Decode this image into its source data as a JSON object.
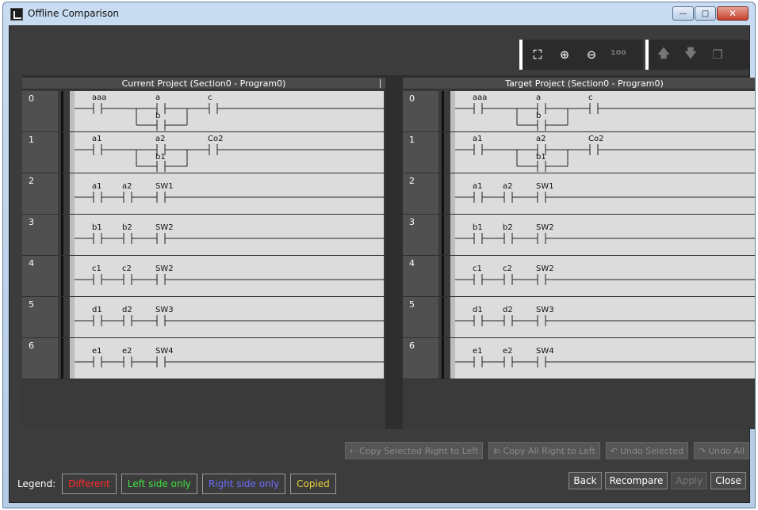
{
  "window": {
    "title": "Offline Comparison",
    "minimize": "—",
    "maximize": "□",
    "close": "✕"
  },
  "toolbar": {
    "group1": [
      {
        "icon": "fit-to-window-icon",
        "glyph": "⛶",
        "disabled": false
      },
      {
        "icon": "zoom-in-icon",
        "glyph": "⊕",
        "disabled": false
      },
      {
        "icon": "zoom-out-icon",
        "glyph": "⊖",
        "disabled": false
      },
      {
        "icon": "zoom-100-icon",
        "glyph": "¹⁰⁰",
        "disabled": true
      }
    ],
    "group2": [
      {
        "icon": "previous-difference-icon",
        "glyph": "🡅",
        "disabled": true
      },
      {
        "icon": "next-difference-icon",
        "glyph": "🡇",
        "disabled": true
      },
      {
        "icon": "copy-window-icon",
        "glyph": "❐",
        "disabled": true
      }
    ]
  },
  "panels": {
    "left": {
      "title": "Current Project (Section0 - Program0)"
    },
    "right": {
      "title": "Target Project (Section0 - Program0)"
    }
  },
  "rungs": [
    {
      "number": "0",
      "type": "or",
      "contacts": [
        "aaa",
        "a",
        "c"
      ],
      "branch": "b"
    },
    {
      "number": "1",
      "type": "or",
      "contacts": [
        "a1",
        "a2",
        "Co2"
      ],
      "branch": "b1"
    },
    {
      "number": "2",
      "type": "series",
      "contacts": [
        "a1",
        "a2",
        "SW1"
      ]
    },
    {
      "number": "3",
      "type": "series",
      "contacts": [
        "b1",
        "b2",
        "SW2"
      ]
    },
    {
      "number": "4",
      "type": "series",
      "contacts": [
        "c1",
        "c2",
        "SW2"
      ]
    },
    {
      "number": "5",
      "type": "series",
      "contacts": [
        "d1",
        "d2",
        "SW3"
      ]
    },
    {
      "number": "6",
      "type": "series",
      "contacts": [
        "e1",
        "e2",
        "SW4"
      ]
    }
  ],
  "actions": {
    "copy_selected": "Copy Selected Right to Left",
    "copy_all": "Copy All Right to Left",
    "undo_selected": "Undo Selected",
    "undo_all": "Undo All"
  },
  "legend": {
    "label": "Legend:",
    "items": [
      {
        "text": "Different",
        "color": "#ff2a2a"
      },
      {
        "text": "Left side only",
        "color": "#3ee23e"
      },
      {
        "text": "Right side only",
        "color": "#6b6bff"
      },
      {
        "text": "Copied",
        "color": "#e8d23a"
      }
    ]
  },
  "buttons": {
    "back": "Back",
    "recompare": "Recompare",
    "apply": "Apply",
    "close": "Close"
  }
}
